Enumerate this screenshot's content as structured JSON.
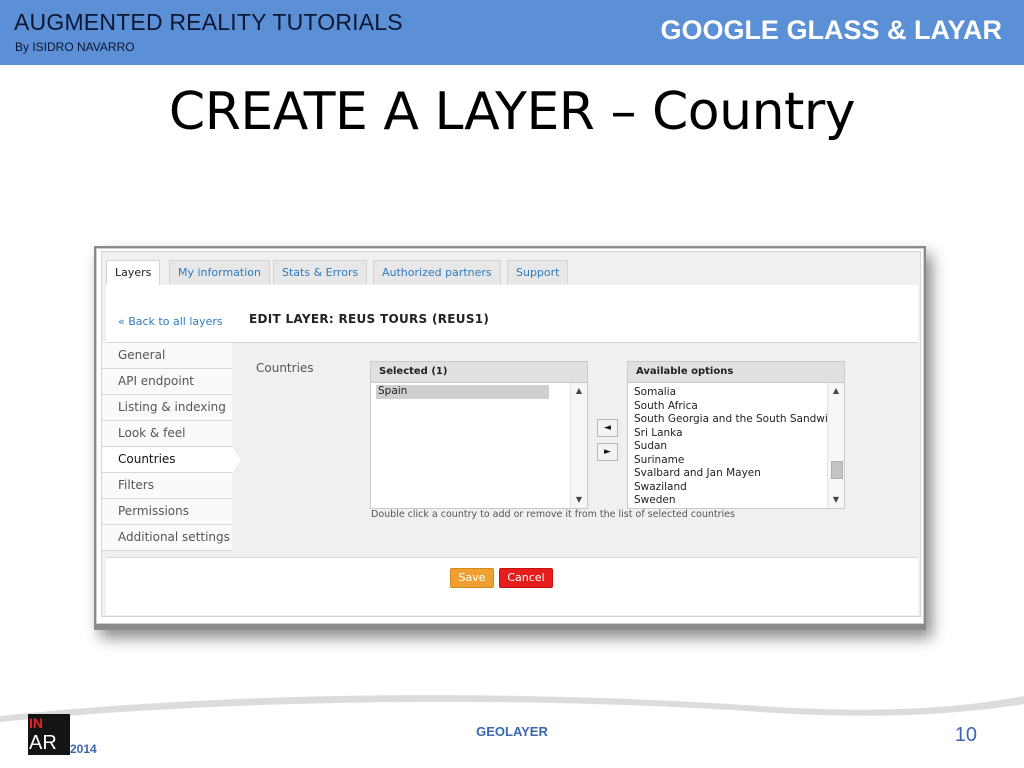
{
  "header": {
    "title": "AUGMENTED REALITY TUTORIALS",
    "author": "By ISIDRO NAVARRO",
    "topic": "GOOGLE GLASS & LAYAR",
    "color": "#5b8fd6"
  },
  "slide_title": "CREATE A LAYER – Country",
  "app": {
    "tabs": [
      "Layers",
      "My information",
      "Stats & Errors",
      "Authorized partners",
      "Support"
    ],
    "active_tab": "Layers",
    "back_link": "« Back to all layers",
    "edit_title": "EDIT LAYER: REUS TOURS (REUS1)",
    "sidebar": [
      "General",
      "API endpoint",
      "Listing & indexing",
      "Look & feel",
      "Countries",
      "Filters",
      "Permissions",
      "Additional settings"
    ],
    "active_sidebar": "Countries",
    "field_label": "Countries",
    "selected": {
      "header": "Selected (1)",
      "items": [
        "Spain"
      ]
    },
    "available": {
      "header": "Available options",
      "items": [
        "Somalia",
        "South Africa",
        "South Georgia and the South Sandwich Islands",
        "Sri Lanka",
        "Sudan",
        "Suriname",
        "Svalbard and Jan Mayen",
        "Swaziland",
        "Sweden"
      ]
    },
    "move_left_icon": "arrow-left-icon",
    "move_right_icon": "arrow-right-icon",
    "hint": "Double click a country to add or remove it from the list of selected countries",
    "save_label": "Save",
    "cancel_label": "Cancel",
    "save_color": "#f0a030",
    "cancel_color": "#e51d1d"
  },
  "footer": {
    "logo_top": "IN",
    "logo_bottom": "AR",
    "year": "2014",
    "section": "GEOLAYER",
    "page_number": "10"
  }
}
